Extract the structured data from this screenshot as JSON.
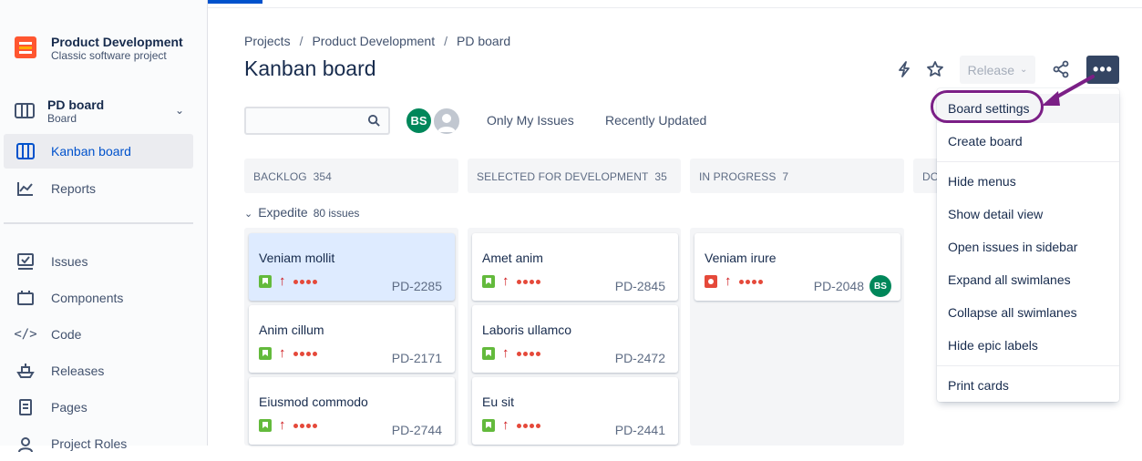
{
  "sidebar": {
    "project": {
      "name": "Product Development",
      "type": "Classic software project"
    },
    "board": {
      "name": "PD board",
      "type": "Board"
    },
    "items_top": [
      {
        "label": "Kanban board",
        "icon": "board-columns-icon",
        "active": true
      },
      {
        "label": "Reports",
        "icon": "line-chart-icon",
        "active": false
      }
    ],
    "items_bottom": [
      {
        "label": "Issues",
        "icon": "issues-icon"
      },
      {
        "label": "Components",
        "icon": "components-icon"
      },
      {
        "label": "Code",
        "icon": "code-icon"
      },
      {
        "label": "Releases",
        "icon": "ship-icon"
      },
      {
        "label": "Pages",
        "icon": "page-icon"
      },
      {
        "label": "Project Roles",
        "icon": "roles-icon"
      }
    ]
  },
  "header": {
    "breadcrumb": [
      "Projects",
      "Product Development",
      "PD board"
    ],
    "title": "Kanban board",
    "release_label": "Release",
    "more_label": "•••"
  },
  "filters": {
    "search_placeholder": "",
    "avatar_initials": "BS",
    "only_my_issues": "Only My Issues",
    "recently_updated": "Recently Updated"
  },
  "columns": [
    {
      "name": "BACKLOG",
      "count": "354"
    },
    {
      "name": "SELECTED FOR DEVELOPMENT",
      "count": "35"
    },
    {
      "name": "IN PROGRESS",
      "count": "7"
    },
    {
      "name": "DO",
      "count": ""
    }
  ],
  "swimlane": {
    "label": "Expedite",
    "count": "80 issues"
  },
  "cards": {
    "backlog": [
      {
        "title": "Veniam mollit",
        "key": "PD-2285",
        "type": "story",
        "selected": true
      },
      {
        "title": "Anim cillum",
        "key": "PD-2171",
        "type": "story"
      },
      {
        "title": "Eiusmod commodo",
        "key": "PD-2744",
        "type": "story"
      }
    ],
    "selected": [
      {
        "title": "Amet anim",
        "key": "PD-2845",
        "type": "story"
      },
      {
        "title": "Laboris ullamco",
        "key": "PD-2472",
        "type": "story"
      },
      {
        "title": "Eu sit",
        "key": "PD-2441",
        "type": "story"
      }
    ],
    "in_progress": [
      {
        "title": "Veniam irure",
        "key": "PD-2048",
        "type": "bug",
        "assignee": "BS"
      }
    ]
  },
  "menu": {
    "items": [
      "Board settings",
      "Create board",
      "Hide menus",
      "Show detail view",
      "Open issues in sidebar",
      "Expand all swimlanes",
      "Collapse all swimlanes",
      "Hide epic labels",
      "Print cards"
    ]
  },
  "colors": {
    "accent": "#0052cc",
    "annotation": "#7b1f86",
    "story": "#63ba3c",
    "bug": "#e5493a"
  }
}
